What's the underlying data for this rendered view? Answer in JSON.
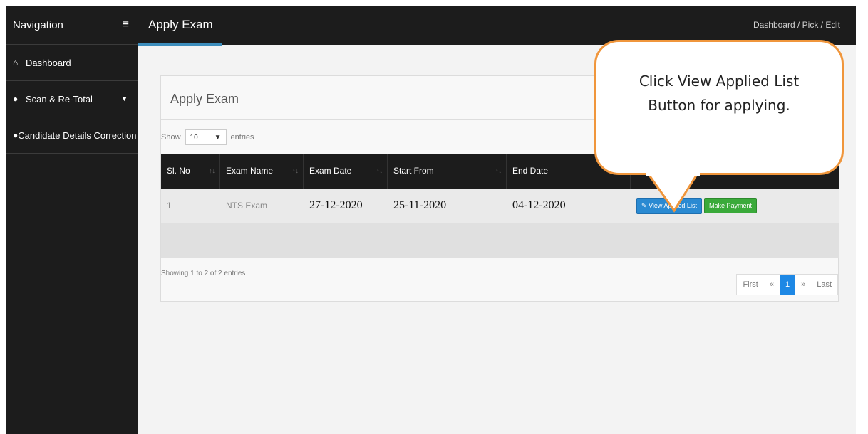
{
  "sidebar": {
    "title": "Navigation",
    "menu_icon": "hamburger-icon",
    "items": [
      {
        "icon": "home-icon",
        "label": "Dashboard"
      },
      {
        "icon": "user-icon",
        "label": "Scan & Re-Total",
        "has_chevron": true
      },
      {
        "icon": "user-icon",
        "label": "Candidate Details Correction Li"
      }
    ]
  },
  "header": {
    "title": "Apply Exam",
    "breadcrumb": "Dashboard  /  Pick  /  Edit"
  },
  "card": {
    "title": "Apply Exam",
    "show_label": "Show",
    "entries_value": "10",
    "entries_label": "entries",
    "columns": [
      "Sl. No",
      "Exam Name",
      "Exam Date",
      "Start From",
      "End Date",
      ""
    ],
    "rows": [
      {
        "sl": "1",
        "exam_name": "NTS Exam",
        "exam_date": "27-12-2020",
        "start_from": "25-11-2020",
        "end_date": "04-12-2020",
        "view_button": "View Applied List",
        "pay_button": "Make Payment"
      }
    ],
    "info": "Showing 1 to 2 of 2 entries",
    "pagination": {
      "first": "First",
      "prev": "«",
      "current": "1",
      "next": "»",
      "last": "Last"
    }
  },
  "callout": {
    "line1": "Click View Applied List",
    "line2": "Button for applying."
  },
  "colors": {
    "dark_bg": "#1c1c1c",
    "accent": "#3c8dbc",
    "view_button": "#2a8ad2",
    "pay_button": "#3aaa3a",
    "callout_border": "#f0963c"
  }
}
